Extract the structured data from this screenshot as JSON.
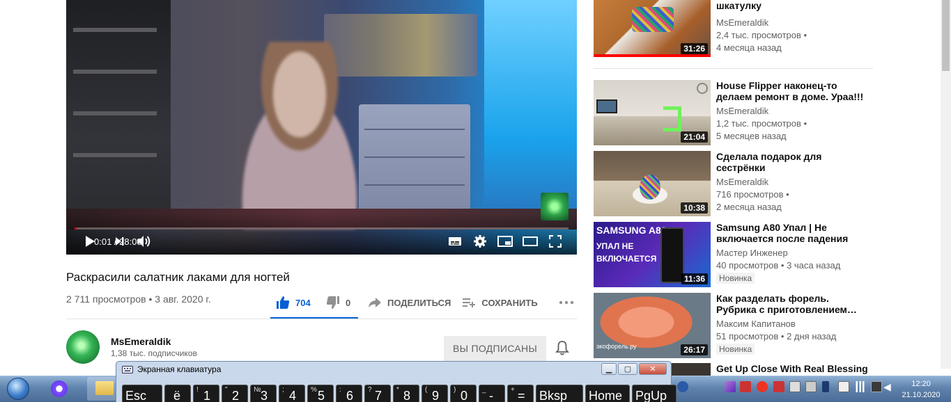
{
  "player": {
    "time_current": "0:01",
    "time_separator": " / ",
    "time_total": "28:08",
    "progress": 0.001
  },
  "video": {
    "title": "Раскрасили салатник лаками для ногтей",
    "views": "2 711 просмотров",
    "dot": " • ",
    "date": "3 авг. 2020 г.",
    "likes": "704",
    "dislikes": "0",
    "share_label": "ПОДЕЛИТЬСЯ",
    "save_label": "СОХРАНИТЬ"
  },
  "channel": {
    "name": "MsEmeraldik",
    "subscribers": "1,38 тыс. подписчиков",
    "subscribe_label": "ВЫ ПОДПИСАНЫ"
  },
  "sidebar": {
    "items": [
      {
        "title": "шкатулку",
        "channel": "MsEmeraldik",
        "views": "2,4 тыс. просмотров",
        "sep": " •",
        "age": "4 месяца назад",
        "duration": "31:26",
        "watched": 1.0,
        "badge": ""
      },
      {
        "title": "House Flipper наконец-то делаем ремонт в доме. Ураа!!!",
        "channel": "MsEmeraldik",
        "views": "1,2 тыс. просмотров",
        "sep": " •",
        "age": "5 месяцев назад",
        "duration": "21:04",
        "watched": 0,
        "badge": ""
      },
      {
        "title": "Сделала подарок для сестрёнки",
        "channel": "MsEmeraldik",
        "views": "716 просмотров",
        "sep": " •",
        "age": "2 месяца назад",
        "duration": "10:38",
        "watched": 0,
        "badge": ""
      },
      {
        "title": "Samsung A80 Упал | Не включается после падения",
        "channel": "Мастер Инженер",
        "views": "40 просмотров",
        "sep": " • ",
        "age": "3 часа назад",
        "duration": "11:36",
        "watched": 0,
        "badge": "Новинка"
      },
      {
        "title": "Как разделать форель. Рубрика с приготовлением…",
        "channel": "Максим Капитанов",
        "views": "51 просмотров",
        "sep": " • ",
        "age": "2 дня назад",
        "duration": "26:17",
        "watched": 0,
        "badge": "Новинка"
      },
      {
        "title": "Get Up Close With Real Blessing"
      }
    ],
    "thumb_texts": {
      "samsung_top": "SAMSUNG A80",
      "samsung_bottom": "УПАЛ НЕ ВКЛЮЧАЕТСЯ",
      "trout_site": "экофорель.ру"
    }
  },
  "osk": {
    "title": "Экранная клавиатура",
    "keys": [
      {
        "main": "Esc",
        "sup": ""
      },
      {
        "main": "ё",
        "sup": ""
      },
      {
        "main": "1",
        "sup": "!"
      },
      {
        "main": "2",
        "sup": "\""
      },
      {
        "main": "3",
        "sup": "№"
      },
      {
        "main": "4",
        "sup": ";"
      },
      {
        "main": "5",
        "sup": "%"
      },
      {
        "main": "6",
        "sup": ":"
      },
      {
        "main": "7",
        "sup": "?"
      },
      {
        "main": "8",
        "sup": "*"
      },
      {
        "main": "9",
        "sup": "("
      },
      {
        "main": "0",
        "sup": ")"
      },
      {
        "main": "-",
        "sup": "_"
      },
      {
        "main": "=",
        "sup": "+"
      },
      {
        "main": "Bksp",
        "sup": ""
      },
      {
        "main": "Home",
        "sup": ""
      },
      {
        "main": "PgUp",
        "sup": ""
      }
    ]
  },
  "taskbar": {
    "time": "12:20",
    "date": "21.10.2020"
  },
  "colors": {
    "accent_blue": "#065fd4",
    "progress_red": "#ff0000",
    "meta_gray": "#606060"
  }
}
